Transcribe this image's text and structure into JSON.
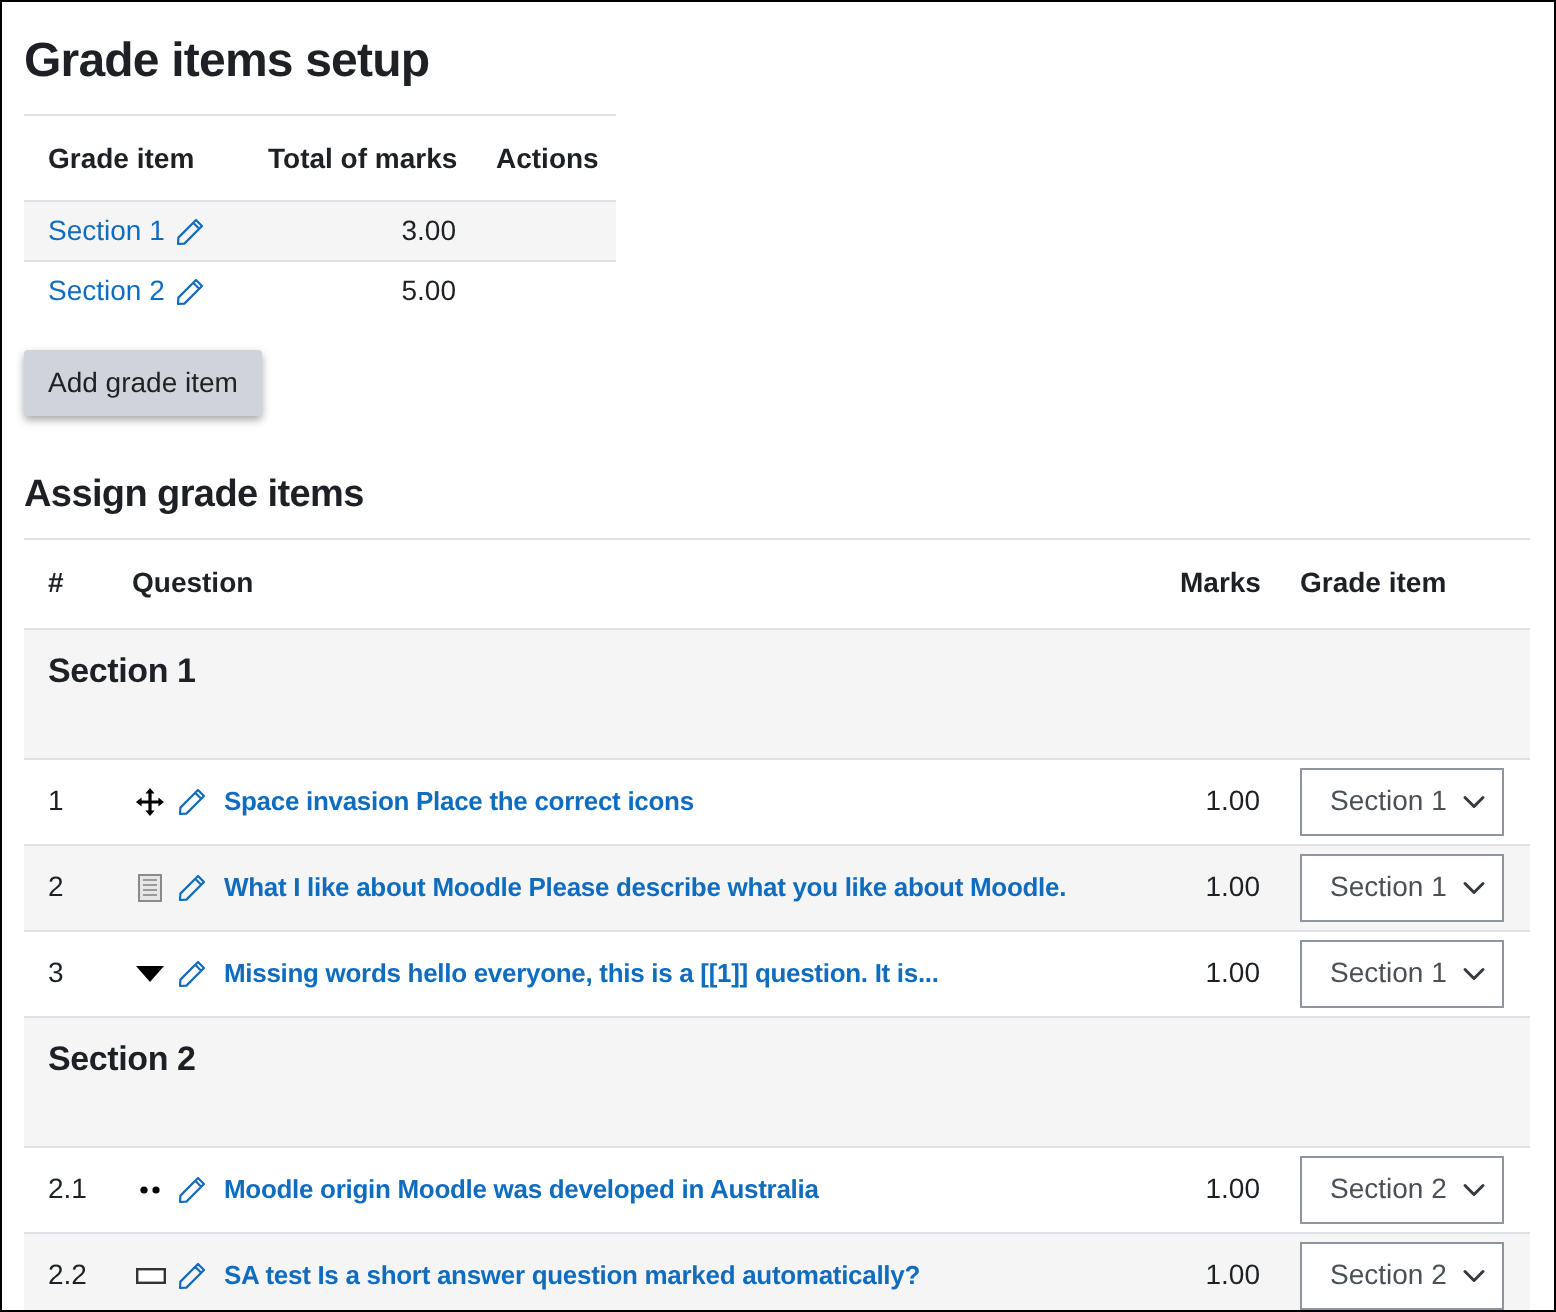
{
  "page": {
    "title": "Grade items setup"
  },
  "grade_items": {
    "columns": [
      "Grade item",
      "Total of marks",
      "Actions"
    ],
    "rows": [
      {
        "name": "Section 1",
        "total": "3.00"
      },
      {
        "name": "Section 2",
        "total": "5.00"
      }
    ]
  },
  "add_button": {
    "label": "Add grade item"
  },
  "assign": {
    "title": "Assign grade items",
    "columns": [
      "#",
      "Question",
      "Marks",
      "Grade item"
    ],
    "sections": [
      {
        "heading": "Section 1",
        "questions": [
          {
            "number": "1",
            "kind": "dragdrop",
            "text": "Space invasion Place the correct icons",
            "marks": "1.00",
            "grade_item": "Section 1"
          },
          {
            "number": "2",
            "kind": "essay",
            "text": "What I like about Moodle Please describe what you like about Moodle.",
            "marks": "1.00",
            "grade_item": "Section 1"
          },
          {
            "number": "3",
            "kind": "gapselect",
            "text": "Missing words hello everyone, this is a [[1]] question. It is...",
            "marks": "1.00",
            "grade_item": "Section 1"
          }
        ]
      },
      {
        "heading": "Section 2",
        "questions": [
          {
            "number": "2.1",
            "kind": "markers",
            "text": "Moodle origin Moodle was developed in Australia",
            "marks": "1.00",
            "grade_item": "Section 2"
          },
          {
            "number": "2.2",
            "kind": "shortanswer",
            "text": "SA test Is a short answer question marked automatically?",
            "marks": "1.00",
            "grade_item": "Section 2"
          }
        ]
      }
    ]
  }
}
